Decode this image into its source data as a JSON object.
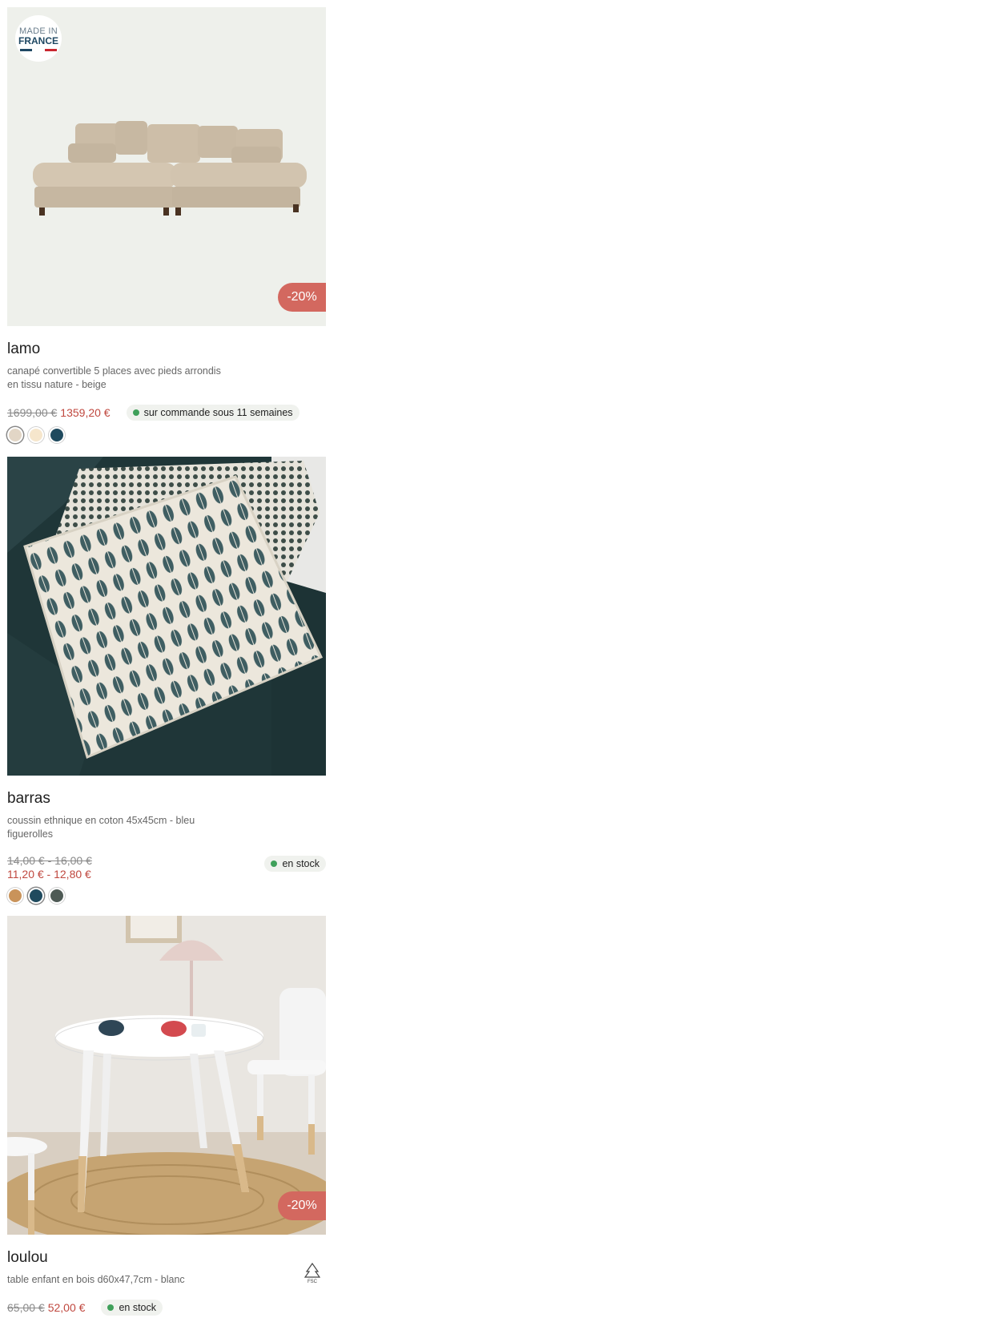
{
  "products": [
    {
      "name": "lamo",
      "description": "canapé convertible 5 places avec pieds arrondis en tissu nature - beige",
      "old_price": "1699,00 €",
      "new_price": "1359,20 €",
      "stock": "sur commande sous 11 semaines",
      "badge": "-20%",
      "made_in_france": {
        "line1": "MADE IN",
        "line2": "FRANCE"
      },
      "colors": [
        "#e2d6c6",
        "#f6e6cc",
        "#1f4a5e"
      ]
    },
    {
      "name": "barras",
      "description": "coussin ethnique en coton 45x45cm - bleu figuerolles",
      "old_price": "14,00 € - 16,00 €",
      "new_price": "11,20 € - 12,80 €",
      "stock": "en stock",
      "colors": [
        "#c9935a",
        "#1f4a5e",
        "#4e5a55"
      ]
    },
    {
      "name": "loulou",
      "description": "table enfant en bois d60x47,7cm - blanc",
      "old_price": "65,00 €",
      "new_price": "52,00 €",
      "stock": "en stock",
      "badge": "-20%",
      "label": "FSC"
    }
  ]
}
